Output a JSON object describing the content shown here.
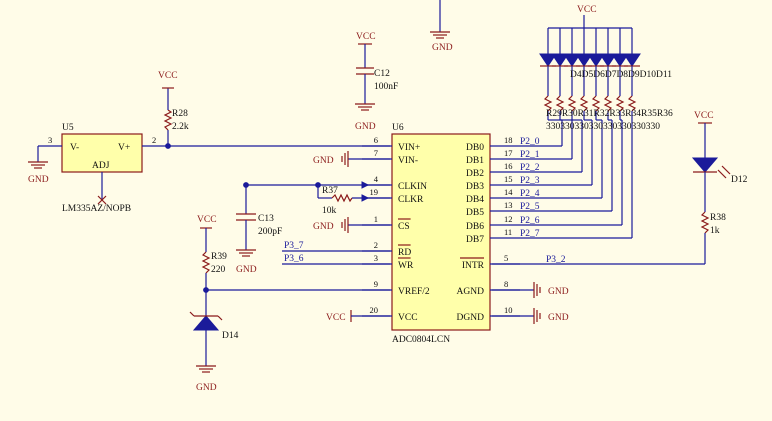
{
  "colors": {
    "background": "#FFFCE8",
    "wire": "#1b1b9a",
    "component": "#8b1a1a",
    "ic_fill": "#FFFFAA"
  },
  "power": {
    "vcc": "VCC",
    "gnd": "GND"
  },
  "u5": {
    "ref": "U5",
    "part": "LM335AZ/NOPB",
    "pin_vneg": "V-",
    "pin_vpos": "V+",
    "pin_adj": "ADJ",
    "pin3": "3",
    "pin2": "2"
  },
  "r28": {
    "ref": "R28",
    "value": "2.2k"
  },
  "c12": {
    "ref": "C12",
    "value": "100nF"
  },
  "c13": {
    "ref": "C13",
    "value": "200pF"
  },
  "r37": {
    "ref": "R37",
    "value": "10k"
  },
  "r39": {
    "ref": "R39",
    "value": "220"
  },
  "d14": {
    "ref": "D14"
  },
  "d12": {
    "ref": "D12"
  },
  "r38": {
    "ref": "R38",
    "value": "1k"
  },
  "led_array_label": "D4D5D6D7D8D9D10D11",
  "resistor_array_label": "R29R30R31R32R33R34R35R36",
  "resistor_values_label": "330330330330330330330330",
  "u6": {
    "ref": "U6",
    "part": "ADC0804LCN",
    "left_pins": [
      {
        "num": "6",
        "name": "VIN+"
      },
      {
        "num": "7",
        "name": "VIN-"
      },
      {
        "num": "4",
        "name": "CLKIN"
      },
      {
        "num": "19",
        "name": "CLKR"
      },
      {
        "num": "1",
        "name": "CS"
      },
      {
        "num": "2",
        "name": "RD"
      },
      {
        "num": "3",
        "name": "WR"
      },
      {
        "num": "9",
        "name": "VREF/2"
      },
      {
        "num": "20",
        "name": "VCC"
      }
    ],
    "right_pins": [
      {
        "num": "18",
        "name": "DB0",
        "net": "P2_0"
      },
      {
        "num": "17",
        "name": "DB1",
        "net": "P2_1"
      },
      {
        "num": "16",
        "name": "DB2",
        "net": "P2_2"
      },
      {
        "num": "15",
        "name": "DB3",
        "net": "P2_3"
      },
      {
        "num": "14",
        "name": "DB4",
        "net": "P2_4"
      },
      {
        "num": "13",
        "name": "DB5",
        "net": "P2_5"
      },
      {
        "num": "12",
        "name": "DB6",
        "net": "P2_6"
      },
      {
        "num": "11",
        "name": "DB7",
        "net": "P2_7"
      },
      {
        "num": "5",
        "name": "INTR",
        "net": "P3_2"
      },
      {
        "num": "8",
        "name": "AGND"
      },
      {
        "num": "10",
        "name": "DGND"
      }
    ]
  },
  "nets": {
    "p3_7": "P3_7",
    "p3_6": "P3_6"
  }
}
